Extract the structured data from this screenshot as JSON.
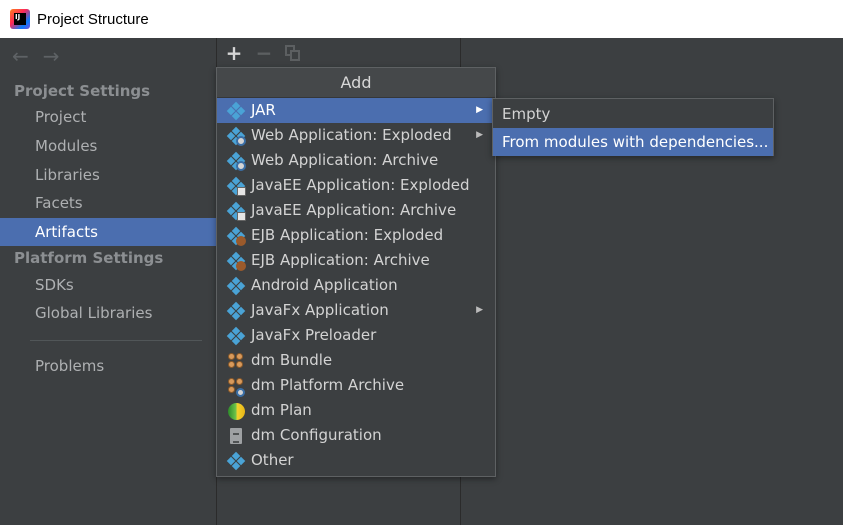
{
  "window": {
    "title": "Project Structure",
    "icon": "intellij-idea-logo",
    "icon_text": "IJ"
  },
  "nav": {
    "back_icon": "←",
    "forward_icon": "→"
  },
  "sidebar": {
    "project_settings_header": "Project Settings",
    "project_settings_items": [
      "Project",
      "Modules",
      "Libraries",
      "Facets",
      "Artifacts"
    ],
    "platform_settings_header": "Platform Settings",
    "platform_settings_items": [
      "SDKs",
      "Global Libraries"
    ],
    "problems": "Problems",
    "selected": "Artifacts"
  },
  "toolbar": {
    "add": "+",
    "remove": "−",
    "copy_icon": "copy-icon"
  },
  "add_menu": {
    "title": "Add",
    "items": [
      {
        "label": "JAR",
        "icon": "artifact-icon",
        "submenu": true,
        "active": true
      },
      {
        "label": "Web Application: Exploded",
        "icon": "web-artifact-icon",
        "submenu": true
      },
      {
        "label": "Web Application: Archive",
        "icon": "web-artifact-icon"
      },
      {
        "label": "JavaEE Application: Exploded",
        "icon": "javaee-artifact-icon"
      },
      {
        "label": "JavaEE Application: Archive",
        "icon": "javaee-artifact-icon"
      },
      {
        "label": "EJB Application: Exploded",
        "icon": "ejb-artifact-icon"
      },
      {
        "label": "EJB Application: Archive",
        "icon": "ejb-artifact-icon"
      },
      {
        "label": "Android Application",
        "icon": "artifact-icon"
      },
      {
        "label": "JavaFx Application",
        "icon": "artifact-icon",
        "submenu": true
      },
      {
        "label": "JavaFx Preloader",
        "icon": "artifact-icon"
      },
      {
        "label": "dm Bundle",
        "icon": "dm-bundle-icon"
      },
      {
        "label": "dm Platform Archive",
        "icon": "dm-platform-archive-icon"
      },
      {
        "label": "dm Plan",
        "icon": "dm-plan-icon"
      },
      {
        "label": "dm Configuration",
        "icon": "dm-configuration-icon"
      },
      {
        "label": "Other",
        "icon": "artifact-icon"
      }
    ]
  },
  "jar_submenu": {
    "items": [
      "Empty",
      "From modules with dependencies..."
    ],
    "active": "From modules with dependencies..."
  },
  "colors": {
    "background": "#3c3f41",
    "selection": "#4b6eaf",
    "artifact_icon": "#4aa3d6"
  }
}
